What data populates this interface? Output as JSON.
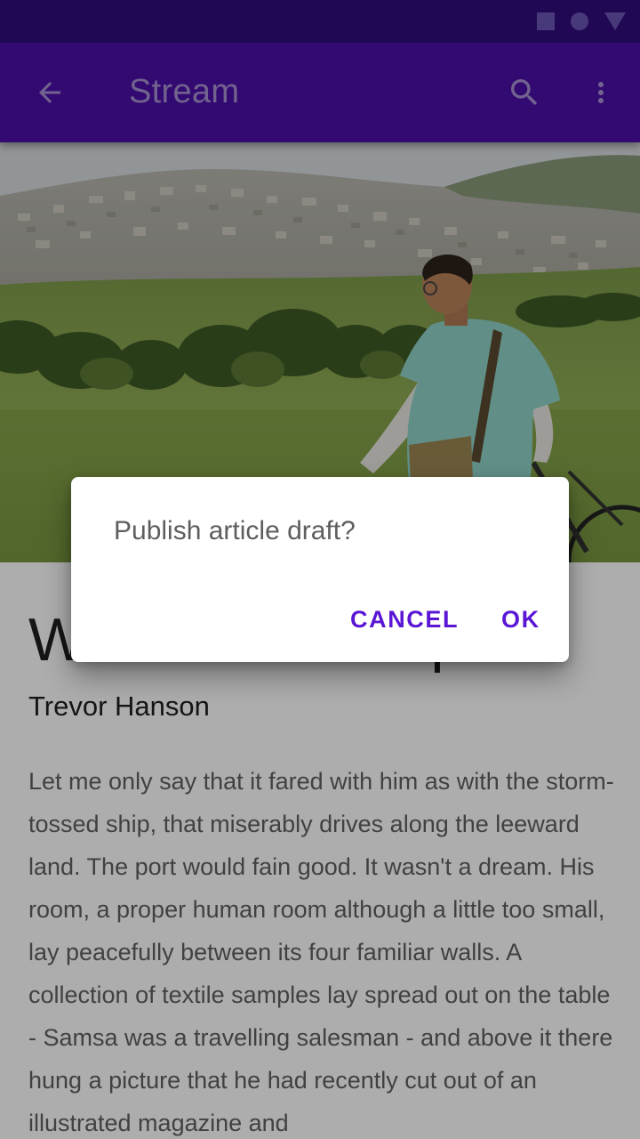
{
  "status_bar": {
    "icons": [
      "stop-square-icon",
      "home-circle-icon",
      "back-triangle-icon"
    ],
    "background": "#300d7e"
  },
  "app_bar": {
    "title": "Stream",
    "background": "#4a10a8",
    "icons": [
      "arrow-back-icon",
      "search-icon",
      "more-vert-icon"
    ]
  },
  "hero": {
    "description_icon": "hero-photo"
  },
  "article": {
    "title": "Wood Landscape",
    "author": "Trevor Hanson",
    "body": "Let me only say that it fared with him as with the storm-tossed ship, that miserably drives along the leeward land. The port would fain good. It wasn't a dream. His room, a proper human room although a little too small, lay peacefully between its four familiar walls. A collection of textile samples lay spread out on the table - Samsa was a travelling salesman - and above it there hung a picture that he had recently cut out of an illustrated magazine and"
  },
  "dialog": {
    "message": "Publish article draft?",
    "cancel_label": "CANCEL",
    "ok_label": "OK",
    "accent": "#5a16d4"
  }
}
